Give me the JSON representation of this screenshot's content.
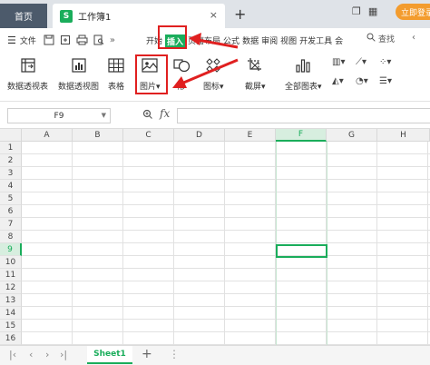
{
  "titlebar": {
    "home_tab": "首页",
    "doc_icon": "S",
    "doc_title": "工作簿1",
    "close": "×",
    "new_tab": "+",
    "login_button": "立即登录"
  },
  "menu": {
    "file": "文件",
    "more": "»",
    "tabs": [
      "开始",
      "插入",
      "页面布局",
      "公式",
      "数据",
      "审阅",
      "视图",
      "开发工具",
      "会"
    ],
    "active_tab": "插入",
    "search": "查找",
    "more_right": "‹"
  },
  "toolbar": {
    "items": [
      {
        "label": "数据透视表",
        "icon": "pivot-table-icon"
      },
      {
        "label": "数据透视图",
        "icon": "pivot-chart-icon"
      },
      {
        "label": "表格",
        "icon": "table-icon"
      },
      {
        "label": "图片",
        "icon": "picture-icon"
      },
      {
        "label": "形",
        "icon": "shape-icon"
      },
      {
        "label": "图标",
        "icon": "icon-library-icon"
      },
      {
        "label": "截屏",
        "icon": "screenshot-icon"
      },
      {
        "label": "全部图表",
        "icon": "all-charts-icon"
      }
    ],
    "dropdown_arrow": "▾"
  },
  "formula": {
    "name_box": "F9",
    "fx": "fx"
  },
  "grid": {
    "columns": [
      "A",
      "B",
      "C",
      "D",
      "E",
      "F",
      "G",
      "H"
    ],
    "rows": [
      "1",
      "2",
      "3",
      "4",
      "5",
      "6",
      "7",
      "8",
      "9",
      "10",
      "11",
      "12",
      "13",
      "14",
      "15",
      "16"
    ],
    "selected_column": "F",
    "selected_row": "9"
  },
  "sheets": {
    "tabs": [
      "Sheet1"
    ],
    "add": "+"
  },
  "colors": {
    "accent_green": "#1aad5b",
    "highlight_red": "#e02020",
    "login_orange": "#f39c2e"
  }
}
